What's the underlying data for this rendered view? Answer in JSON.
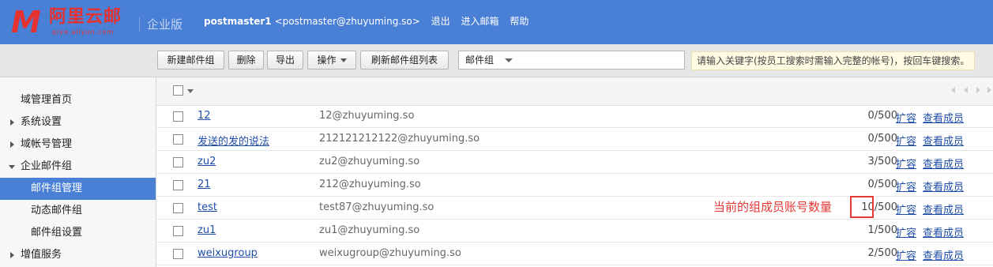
{
  "header": {
    "logo_mark": "M",
    "logo_cn": "阿里云邮",
    "logo_en": "qiye.aliyun.com",
    "edition": "企业版",
    "user_name": "postmaster1",
    "user_email": "<postmaster@zhuyuming.so>",
    "links": [
      "退出",
      "进入邮箱",
      "帮助"
    ],
    "bg_color": "#4a7fd6"
  },
  "toolbar": {
    "new_group": "新建邮件组",
    "delete": "删除",
    "export": "导出",
    "operate": "操作",
    "refresh": "刷新邮件组列表",
    "filter_selected": "邮件组",
    "search_value": "",
    "search_tip": "请输入关键字(按员工搜索时需输入完整的帐号)，按回车键搜索。"
  },
  "sidebar": {
    "items": [
      {
        "label": "域管理首页",
        "indent": 0,
        "arrow": "none"
      },
      {
        "label": "系统设置",
        "indent": 0,
        "arrow": "collapsed"
      },
      {
        "label": "域帐号管理",
        "indent": 0,
        "arrow": "collapsed"
      },
      {
        "label": "企业邮件组",
        "indent": 0,
        "arrow": "expanded"
      },
      {
        "label": "邮件组管理",
        "indent": 1,
        "arrow": "none",
        "active": true
      },
      {
        "label": "动态邮件组",
        "indent": 1,
        "arrow": "none"
      },
      {
        "label": "邮件组设置",
        "indent": 1,
        "arrow": "none"
      },
      {
        "label": "增值服务",
        "indent": 0,
        "arrow": "collapsed"
      }
    ],
    "active_color": "#4a7fd6"
  },
  "list": {
    "rows": [
      {
        "name": "12",
        "email": "12@zhuyuming.so",
        "count": "0/500",
        "expand": "扩容",
        "members": "查看成员"
      },
      {
        "name": "发送的发的说法",
        "email": "212121212122@zhuyuming.so",
        "count": "0/500",
        "expand": "扩容",
        "members": "查看成员"
      },
      {
        "name": "zu2",
        "email": "zu2@zhuyuming.so",
        "count": "3/500",
        "expand": "扩容",
        "members": "查看成员"
      },
      {
        "name": "21",
        "email": "212@zhuyuming.so",
        "count": "0/500",
        "expand": "扩容",
        "members": "查看成员"
      },
      {
        "name": "test",
        "email": "test87@zhuyuming.so",
        "count": "10/500",
        "expand": "扩容",
        "members": "查看成员"
      },
      {
        "name": "zu1",
        "email": "zu1@zhuyuming.so",
        "count": "1/500",
        "expand": "扩容",
        "members": "查看成员"
      },
      {
        "name": "weixugroup",
        "email": "weixugroup@zhuyuming.so",
        "count": "2/500",
        "expand": "扩容",
        "members": "查看成员"
      }
    ]
  },
  "annotation": {
    "text": "当前的组成员账号数量",
    "color": "#e53935"
  }
}
